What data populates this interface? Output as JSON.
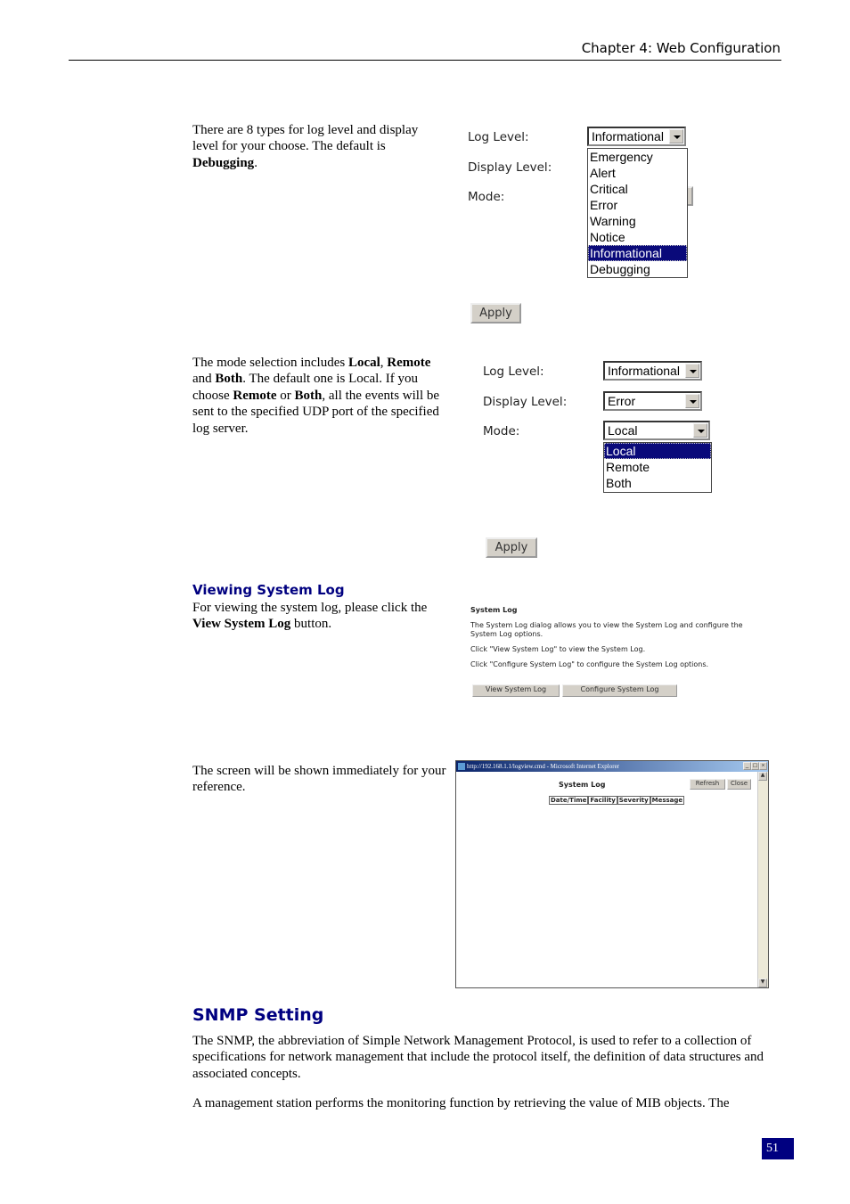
{
  "header": {
    "chapter_title": "Chapter 4: Web Configuration"
  },
  "section1": {
    "text_parts": [
      "There are 8 types for log level and display level for your choose. The default is ",
      "Debugging",
      "."
    ],
    "form": {
      "log_level_label": "Log Level:",
      "display_level_label": "Display Level:",
      "mode_label": "Mode:",
      "log_level_value": "Informational",
      "log_level_options": [
        "Emergency",
        "Alert",
        "Critical",
        "Error",
        "Warning",
        "Notice",
        "Informational",
        "Debugging"
      ],
      "log_level_selected_index": 6,
      "apply_label": "Apply"
    }
  },
  "section2": {
    "text": {
      "t1": "The mode selection includes ",
      "b1": "Local",
      "t2": ", ",
      "b2": "Remote",
      "t3": " and ",
      "b3": "Both",
      "t4": ". The default one is Local. If you choose ",
      "b4": "Remote",
      "t5": " or ",
      "b5": "Both",
      "t6": ", all the events will be sent to the specified UDP port of the specified log server."
    },
    "form": {
      "log_level_label": "Log Level:",
      "display_level_label": "Display Level:",
      "mode_label": "Mode:",
      "log_level_value": "Informational",
      "display_level_value": "Error",
      "mode_value": "Local",
      "mode_options": [
        "Local",
        "Remote",
        "Both"
      ],
      "mode_selected_index": 0,
      "apply_label": "Apply"
    }
  },
  "section3": {
    "heading": "Viewing System Log",
    "text_parts": [
      "For viewing the system log, please click the ",
      "View System Log",
      " button."
    ],
    "panel": {
      "title": "System Log",
      "line1": "The System Log dialog allows you to view the System Log and configure the System Log options.",
      "line2": "Click \"View System Log\" to view the System Log.",
      "line3": "Click \"Configure System Log\" to configure the System Log options.",
      "view_button": "View System Log",
      "configure_button": "Configure System Log"
    }
  },
  "section4": {
    "text": "The screen will be shown immediately for your reference.",
    "window": {
      "title": "http://192.168.1.1/logview.cmd - Microsoft Internet Explorer",
      "heading": "System Log",
      "refresh_button": "Refresh",
      "close_button": "Close",
      "columns": [
        "Date/Time",
        "Facility",
        "Severity",
        "Message"
      ]
    }
  },
  "snmp": {
    "heading": "SNMP Setting",
    "para1": "The SNMP, the abbreviation of Simple Network Management Protocol, is used to refer to a collection of specifications for network management that include the protocol itself, the definition of data structures and associated concepts.",
    "para2": "A management station performs the monitoring function by retrieving the value of MIB objects. The"
  },
  "footer": {
    "page_number": "51"
  }
}
